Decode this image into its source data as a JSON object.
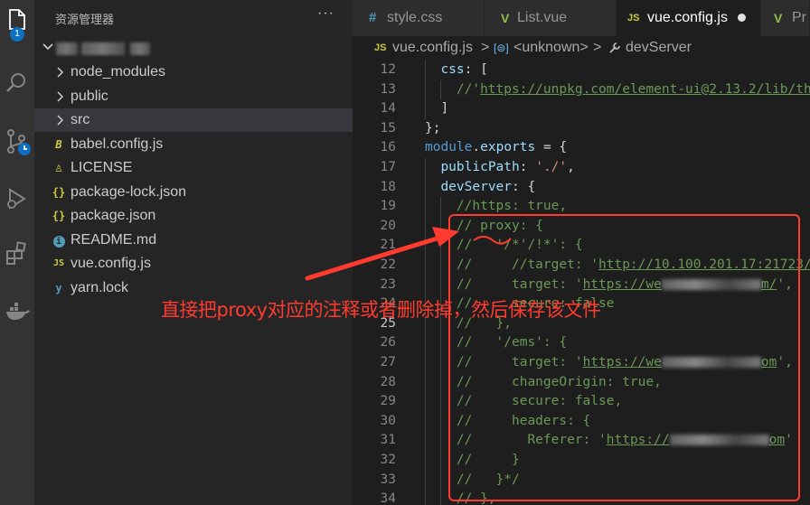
{
  "activity_bar": {
    "items": [
      {
        "name": "explorer",
        "icon": "files-icon",
        "badge": "1"
      },
      {
        "name": "search",
        "icon": "search-icon"
      },
      {
        "name": "source-control",
        "icon": "source-control-icon"
      },
      {
        "name": "run",
        "icon": "run-debug-icon"
      },
      {
        "name": "extensions",
        "icon": "extensions-icon"
      },
      {
        "name": "docker",
        "icon": "docker-icon"
      }
    ]
  },
  "sidebar": {
    "title": "资源管理器",
    "more": "···",
    "items": [
      {
        "label": "node_modules",
        "type": "folder"
      },
      {
        "label": "public",
        "type": "folder"
      },
      {
        "label": "src",
        "type": "folder",
        "selected": true
      },
      {
        "label": "babel.config.js",
        "type": "babel",
        "icon_text": "B"
      },
      {
        "label": "LICENSE",
        "type": "license",
        "icon_text": "♙"
      },
      {
        "label": "package-lock.json",
        "type": "json",
        "icon_text": "{}"
      },
      {
        "label": "package.json",
        "type": "json",
        "icon_text": "{}"
      },
      {
        "label": "README.md",
        "type": "info",
        "icon_text": "i"
      },
      {
        "label": "vue.config.js",
        "type": "js",
        "icon_text": "JS"
      },
      {
        "label": "yarn.lock",
        "type": "yarn",
        "icon_text": "y"
      }
    ]
  },
  "tabs": [
    {
      "label": "style.css",
      "icon_text": "#",
      "icon_color": "#519aba"
    },
    {
      "label": "List.vue",
      "icon_text": "V",
      "icon_color": "#8dc149"
    },
    {
      "label": "vue.config.js",
      "icon_text": "JS",
      "icon_color": "#cbcb41",
      "active": true,
      "dirty": true
    },
    {
      "label": "Pr",
      "icon_text": "V",
      "icon_color": "#8dc149"
    }
  ],
  "breadcrumb": {
    "file_icon": "JS",
    "file": "vue.config.js",
    "sep": ">",
    "symbol1": "<unknown>",
    "symbol2": "devServer"
  },
  "editor": {
    "current_line": 25,
    "lines": [
      {
        "n": "12",
        "indent": 2,
        "tokens": [
          [
            "k",
            "css"
          ],
          [
            "p",
            ": ["
          ]
        ]
      },
      {
        "n": "13",
        "indent": 4,
        "tokens": [
          [
            "c",
            "//'"
          ],
          [
            "cu",
            "https://unpkg.com/element-ui@2.13.2/lib/the"
          ]
        ]
      },
      {
        "n": "14",
        "indent": 2,
        "tokens": [
          [
            "p",
            "]"
          ]
        ]
      },
      {
        "n": "15",
        "indent": 0,
        "tokens": [
          [
            "p",
            "};"
          ]
        ]
      },
      {
        "n": "16",
        "indent": 0,
        "tokens": [
          [
            "kw",
            "module"
          ],
          [
            "p",
            "."
          ],
          [
            "k",
            "exports"
          ],
          [
            "p",
            " = {"
          ]
        ]
      },
      {
        "n": "17",
        "indent": 2,
        "tokens": [
          [
            "k",
            "publicPath"
          ],
          [
            "p",
            ": "
          ],
          [
            "s",
            "'./'"
          ],
          [
            "p",
            ","
          ]
        ]
      },
      {
        "n": "18",
        "indent": 2,
        "tokens": [
          [
            "k",
            "devServer"
          ],
          [
            "p",
            ": {"
          ]
        ]
      },
      {
        "n": "19",
        "indent": 4,
        "tokens": [
          [
            "c",
            "//https: true,"
          ]
        ]
      },
      {
        "n": "20",
        "indent": 4,
        "tokens": [
          [
            "c",
            "// proxy: {"
          ]
        ]
      },
      {
        "n": "21",
        "indent": 4,
        "tokens": [
          [
            "c",
            "//   '/*'/!*': {"
          ]
        ]
      },
      {
        "n": "22",
        "indent": 4,
        "tokens": [
          [
            "c",
            "//     //target: '"
          ],
          [
            "cu",
            "http://10.100.201.17:21723/"
          ]
        ]
      },
      {
        "n": "23",
        "indent": 4,
        "tokens": [
          [
            "c",
            "//     target: '"
          ],
          [
            "cu",
            "https://we"
          ],
          [
            "bl",
            ""
          ],
          [
            "cu",
            "m/"
          ],
          [
            "c",
            "',"
          ]
        ]
      },
      {
        "n": "24",
        "indent": 4,
        "tokens": [
          [
            "c",
            "//     secure: false"
          ]
        ]
      },
      {
        "n": "25",
        "indent": 4,
        "tokens": [
          [
            "c",
            "//   },"
          ]
        ]
      },
      {
        "n": "26",
        "indent": 4,
        "tokens": [
          [
            "c",
            "//   '/ems': {"
          ]
        ]
      },
      {
        "n": "27",
        "indent": 4,
        "tokens": [
          [
            "c",
            "//     target: '"
          ],
          [
            "cu",
            "https://we"
          ],
          [
            "bl",
            ""
          ],
          [
            "cu",
            "om"
          ],
          [
            "c",
            "',"
          ]
        ]
      },
      {
        "n": "28",
        "indent": 4,
        "tokens": [
          [
            "c",
            "//     changeOrigin: true,"
          ]
        ]
      },
      {
        "n": "29",
        "indent": 4,
        "tokens": [
          [
            "c",
            "//     secure: false,"
          ]
        ]
      },
      {
        "n": "30",
        "indent": 4,
        "tokens": [
          [
            "c",
            "//     headers: {"
          ]
        ]
      },
      {
        "n": "31",
        "indent": 4,
        "tokens": [
          [
            "c",
            "//       Referer: '"
          ],
          [
            "cu",
            "https://"
          ],
          [
            "bl",
            ""
          ],
          [
            "cu",
            "om"
          ],
          [
            "c",
            "'"
          ]
        ]
      },
      {
        "n": "32",
        "indent": 4,
        "tokens": [
          [
            "c",
            "//     }"
          ]
        ]
      },
      {
        "n": "33",
        "indent": 4,
        "tokens": [
          [
            "c",
            "//   }*/"
          ]
        ]
      },
      {
        "n": "34",
        "indent": 4,
        "tokens": [
          [
            "c",
            "// },"
          ]
        ]
      }
    ]
  },
  "annotation": {
    "text": "直接把proxy对应的注释或者删除掉，然后保存该文件",
    "color": "#ff3b30"
  }
}
